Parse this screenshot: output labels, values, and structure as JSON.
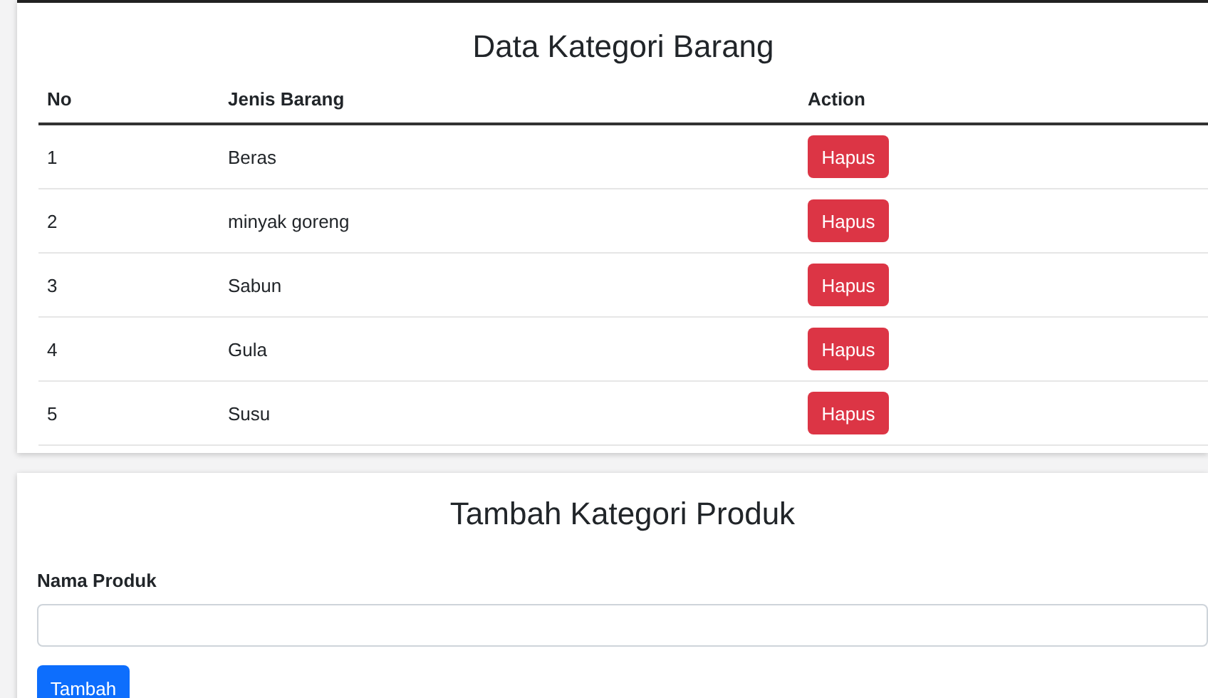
{
  "table_card": {
    "title": "Data Kategori Barang",
    "columns": [
      "No",
      "Jenis Barang",
      "Action"
    ],
    "rows": [
      {
        "no": "1",
        "name": "Beras",
        "action": "Hapus"
      },
      {
        "no": "2",
        "name": "minyak goreng",
        "action": "Hapus"
      },
      {
        "no": "3",
        "name": "Sabun",
        "action": "Hapus"
      },
      {
        "no": "4",
        "name": "Gula",
        "action": "Hapus"
      },
      {
        "no": "5",
        "name": "Susu",
        "action": "Hapus"
      }
    ]
  },
  "form_card": {
    "title": "Tambah Kategori Produk",
    "label": "Nama Produk",
    "button": "Tambah"
  }
}
